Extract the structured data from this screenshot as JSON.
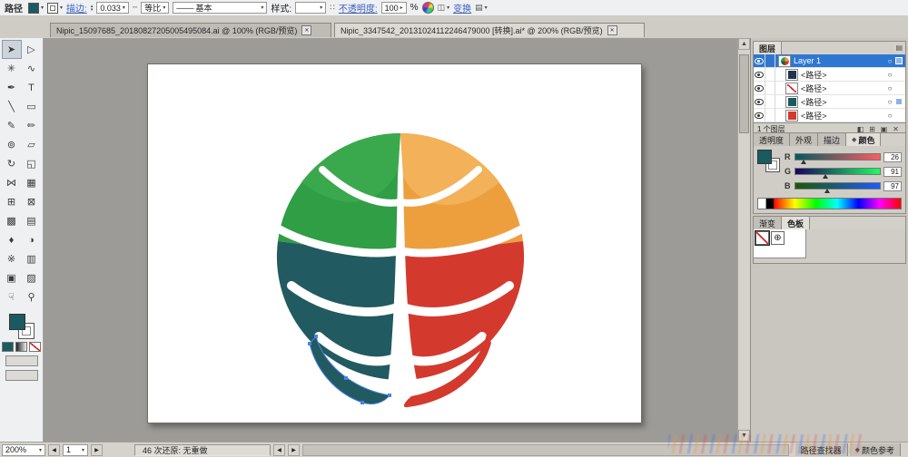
{
  "colors": {
    "fill_teal": "#1a5b61",
    "selection_blue": "#4b82e8",
    "logo_green": "#2f9e45",
    "logo_orange": "#ee9f3d",
    "logo_red": "#d4392e",
    "logo_teal": "#215a60"
  },
  "control_bar": {
    "title": "路径",
    "stroke_label": "描边:",
    "stroke_value": "0.033",
    "profile_icon": "╌",
    "profile": "等比",
    "brush_line": "───",
    "brush": "基本",
    "style_label": "样式:",
    "opacity_label": "不透明度:",
    "opacity_value": "100",
    "percent": "%",
    "transform_label": "变换"
  },
  "doc_tabs": [
    {
      "label": "Nipic_15097685_20180827205005495084.ai @ 100% (RGB/预览)",
      "active": false
    },
    {
      "label": "Nipic_3347542_20131024112246479000 [转换].ai* @ 200% (RGB/预览)",
      "active": true
    }
  ],
  "toolbar": {
    "tools": [
      {
        "name": "selection",
        "glyph": "➤",
        "selected": true
      },
      {
        "name": "direct-selection",
        "glyph": "▷"
      },
      {
        "name": "magic-wand",
        "glyph": "✳"
      },
      {
        "name": "lasso",
        "glyph": "∿"
      },
      {
        "name": "pen",
        "glyph": "✒"
      },
      {
        "name": "type",
        "glyph": "T"
      },
      {
        "name": "line-segment",
        "glyph": "╲"
      },
      {
        "name": "rectangle",
        "glyph": "▭"
      },
      {
        "name": "paintbrush",
        "glyph": "✎"
      },
      {
        "name": "pencil",
        "glyph": "✏"
      },
      {
        "name": "blob-brush",
        "glyph": "⊚"
      },
      {
        "name": "eraser",
        "glyph": "▱"
      },
      {
        "name": "rotate",
        "glyph": "↻"
      },
      {
        "name": "scale",
        "glyph": "◱"
      },
      {
        "name": "width",
        "glyph": "⋈"
      },
      {
        "name": "free-transform",
        "glyph": "▦"
      },
      {
        "name": "shape-builder",
        "glyph": "⊞"
      },
      {
        "name": "perspective-grid",
        "glyph": "⊠"
      },
      {
        "name": "mesh",
        "glyph": "▩"
      },
      {
        "name": "gradient",
        "glyph": "▤"
      },
      {
        "name": "eyedropper",
        "glyph": "♦"
      },
      {
        "name": "blend",
        "glyph": "◑"
      },
      {
        "name": "symbol-sprayer",
        "glyph": "※"
      },
      {
        "name": "column-graph",
        "glyph": "▥"
      },
      {
        "name": "artboard",
        "glyph": "▣"
      },
      {
        "name": "slice",
        "glyph": "▨"
      },
      {
        "name": "hand",
        "glyph": "☟"
      },
      {
        "name": "zoom",
        "glyph": "⚲"
      }
    ]
  },
  "layers_panel": {
    "tab": "图层",
    "menu_icon": "▤",
    "rows": [
      {
        "label": "Layer 1",
        "thumb": "logo",
        "selected": true,
        "sel": true,
        "indent": false
      },
      {
        "label": "<路径>",
        "thumb": "dark",
        "selected": false,
        "sel": false,
        "indent": true
      },
      {
        "label": "<路径>",
        "thumb": "none",
        "selected": false,
        "sel": false,
        "indent": true
      },
      {
        "label": "<路径>",
        "thumb": "teal",
        "selected": false,
        "sel": true,
        "indent": true
      },
      {
        "label": "<路径>",
        "thumb": "red",
        "selected": false,
        "sel": false,
        "indent": true
      }
    ],
    "footer": {
      "count": "1 个图层",
      "icons": [
        {
          "name": "clipping-mask",
          "glyph": "◧"
        },
        {
          "name": "new-sublayer",
          "glyph": "⊞"
        },
        {
          "name": "new-layer",
          "glyph": "▣"
        },
        {
          "name": "delete-layer",
          "glyph": "✕"
        }
      ]
    }
  },
  "color_panel": {
    "tabs": [
      {
        "id": "transparency",
        "label": "透明度",
        "active": false,
        "diamond": false
      },
      {
        "id": "appearance",
        "label": "外观",
        "active": false,
        "diamond": false
      },
      {
        "id": "stroke",
        "label": "描边",
        "active": false,
        "diamond": false
      },
      {
        "id": "color",
        "label": "颜色",
        "active": true,
        "diamond": true
      }
    ],
    "channels": [
      {
        "label": "R",
        "value": "26",
        "pct": 10.2,
        "from": "#005B61",
        "to": "#FF5B61"
      },
      {
        "label": "G",
        "value": "91",
        "pct": 35.7,
        "from": "#1A0061",
        "to": "#1AFF61"
      },
      {
        "label": "B",
        "value": "97",
        "pct": 38.0,
        "from": "#1A5B00",
        "to": "#1A5BFF"
      }
    ]
  },
  "swatch_panel": {
    "tabs": [
      {
        "id": "gradient",
        "label": "渐变",
        "active": false,
        "diamond": false
      },
      {
        "id": "swatches",
        "label": "色板",
        "active": true,
        "diamond": false
      }
    ],
    "registration_glyph": "⊕"
  },
  "status_bar": {
    "zoom": "200%",
    "page": "1",
    "message": "46 次还原: 无重做"
  },
  "bottom_tabs": [
    {
      "id": "pathfinder",
      "label": "路径查找器",
      "active": false,
      "diamond": false
    },
    {
      "id": "color-guide",
      "label": "颜色参考",
      "active": false,
      "diamond": true
    }
  ]
}
